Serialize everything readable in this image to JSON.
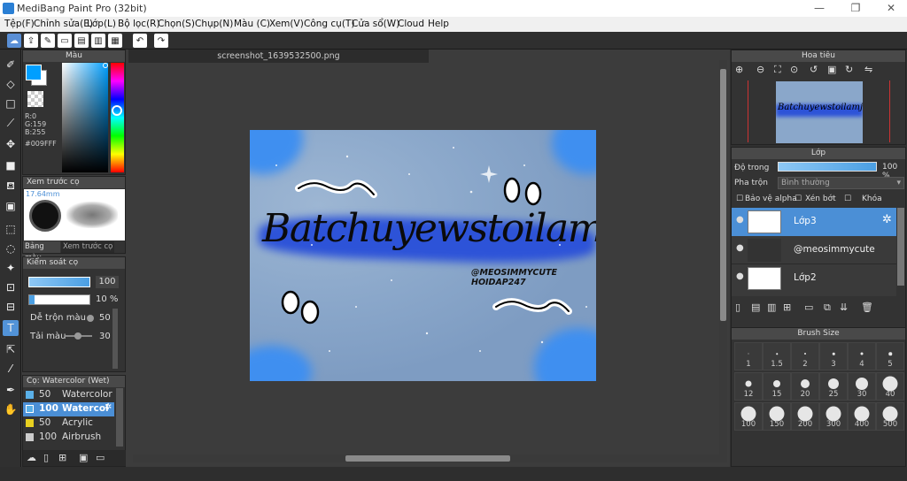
{
  "window": {
    "title": "MediBang Paint Pro (32bit)",
    "min": "—",
    "max": "❐",
    "close": "✕"
  },
  "menu": [
    "Tệp(F)",
    "Chỉnh sửa(E)",
    "Lớp(L)",
    "Bộ lọc(R)",
    "Chọn(S)",
    "Chụp(N)",
    "Màu (C)",
    "Xem(V)",
    "Công cụ(T)",
    "Cửa sổ(W)",
    "Cloud",
    "Help"
  ],
  "color_panel": {
    "title": "Màu",
    "r": "R:0",
    "g": "G:159",
    "b": "B:255",
    "hex": "#009FFF",
    "fg": "#009fff",
    "bg": "#ffffff"
  },
  "brush_preview": {
    "title": "Xem trước cọ",
    "size": "17.64mm",
    "tabs": [
      "Bảng màu",
      "Xem trước cọ"
    ]
  },
  "brush_control": {
    "title": "Kiểm soát cọ",
    "size_value": "100",
    "opacity_value": "10 %",
    "blend_label": "Dễ trộn màu",
    "blend_value": "50",
    "paint_label": "Tải màu",
    "paint_value": "30"
  },
  "brush_list": {
    "title": "Cọ: Watercolor (Wet)",
    "items": [
      {
        "size": "50",
        "name": "Watercolor",
        "color": "#5ab0e8",
        "selected": false
      },
      {
        "size": "100",
        "name": "Watercolor",
        "color": "#5ab0e8",
        "selected": true
      },
      {
        "size": "50",
        "name": "Acrylic",
        "color": "#e8d020",
        "selected": false
      },
      {
        "size": "100",
        "name": "Airbrush",
        "color": "#cccccc",
        "selected": false
      }
    ]
  },
  "document": {
    "tab": "screenshot_1639532500.png",
    "art_text": "Batchuyewstoilamj",
    "art_small_1": "@MEOSIMMYCUTE",
    "art_small_2": "HOIDAP247"
  },
  "navigator": {
    "title": "Hoa tiêu",
    "thumb_text": "Batchuyewstoilamj"
  },
  "layers": {
    "title": "Lớp",
    "opacity_label": "Độ trong",
    "opacity_value": "100 %",
    "blend_label": "Pha trộn",
    "blend_value": "Bình thường",
    "protect_alpha": "Bảo vệ alpha",
    "clipping": "Xén bớt",
    "lock": "Khóa",
    "items": [
      {
        "name": "Lớp3",
        "selected": true
      },
      {
        "name": "@meosimmycute",
        "selected": false
      },
      {
        "name": "Lớp2",
        "selected": false
      }
    ]
  },
  "brush_size": {
    "title": "Brush Size",
    "sizes": [
      "1",
      "1.5",
      "2",
      "3",
      "4",
      "5",
      "12",
      "15",
      "20",
      "25",
      "30",
      "40",
      "100",
      "150",
      "200",
      "300",
      "400",
      "500"
    ]
  },
  "icons": {
    "left_tools": [
      "brush-icon",
      "eraser-icon",
      "rect-select-icon",
      "pen-icon",
      "move-icon",
      "fill-rect-icon",
      "bucket-icon",
      "gradient-icon",
      "lasso-rect-icon",
      "lasso-icon",
      "magic-wand-icon",
      "select-pen-icon",
      "select-eraser-icon",
      "text-icon",
      "operation-icon",
      "eyedropper-icon",
      "pen-tool-icon",
      "hand-icon"
    ]
  }
}
